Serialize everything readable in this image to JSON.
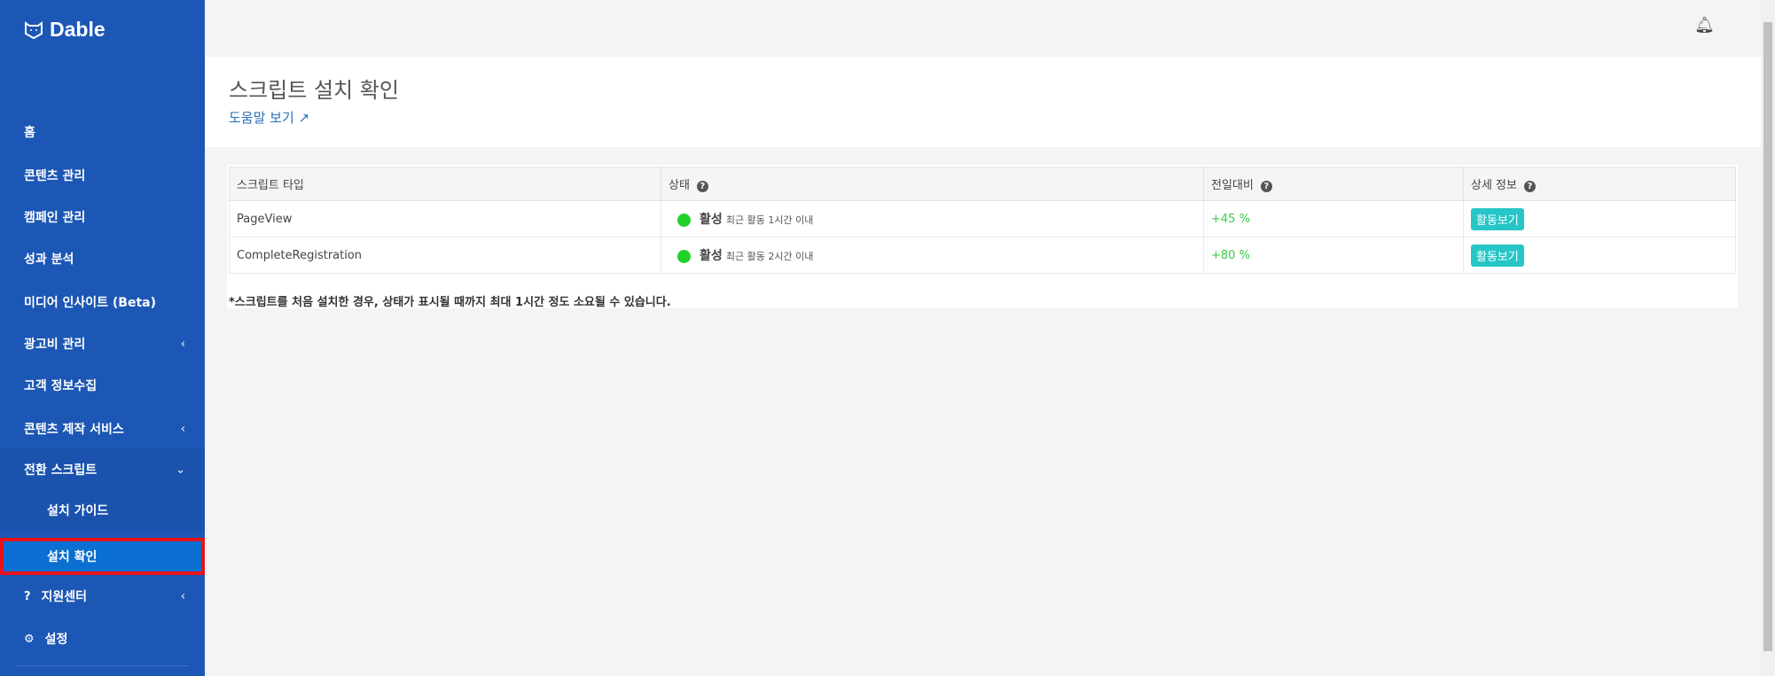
{
  "brand": {
    "name": "Dable"
  },
  "sidebar": {
    "items": [
      {
        "label": "홈"
      },
      {
        "label": "콘텐츠 관리"
      },
      {
        "label": "캠페인 관리"
      },
      {
        "label": "성과 분석"
      },
      {
        "label": "미디어 인사이트 (Beta)"
      },
      {
        "label": "광고비 관리",
        "chevron": "‹"
      },
      {
        "label": "고객 정보수집"
      },
      {
        "label": "콘텐츠 제작 서비스",
        "chevron": "‹"
      },
      {
        "label": "전환 스크립트",
        "chevron": "⌄"
      },
      {
        "label": "설치 가이드"
      },
      {
        "label": "설치 확인"
      },
      {
        "label": "지원센터",
        "icon": "?",
        "chevron": "‹"
      },
      {
        "label": "설정",
        "icon": "⚙"
      }
    ]
  },
  "header": {
    "title": "스크립트 설치 확인",
    "help_link": "도움말 보기"
  },
  "table": {
    "headers": [
      "스크립트 타입",
      "상태",
      "전일대비",
      "상세 정보"
    ],
    "rows": [
      {
        "type": "PageView",
        "status": "활성",
        "status_detail": "최근 활동 1시간 이내",
        "change": "+45 %",
        "action": "활동보기"
      },
      {
        "type": "CompleteRegistration",
        "status": "활성",
        "status_detail": "최근 활동 2시간 이내",
        "change": "+80 %",
        "action": "활동보기"
      }
    ]
  },
  "note": "*스크립트를 처음 설치한 경우, 상태가 표시될 때까지 최대 1시간 정도 소요될 수 있습니다.",
  "colors": {
    "sidebar": "#1c57b5",
    "active": "#0a6fd1",
    "status_active": "#22d12a",
    "button": "#26c6c6"
  }
}
